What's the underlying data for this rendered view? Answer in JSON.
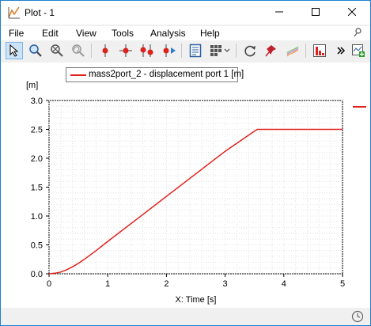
{
  "window": {
    "title": "Plot - 1",
    "controls": [
      "minimize",
      "maximize",
      "close"
    ]
  },
  "menu": {
    "items": [
      "File",
      "Edit",
      "View",
      "Tools",
      "Analysis",
      "Help"
    ],
    "pin_icon": "pin-icon"
  },
  "toolbar": {
    "icons": [
      "pointer-icon",
      "zoom-icon",
      "zoom-out-icon",
      "zoom-reset-icon",
      "marker-icon",
      "crosshair-marker-icon",
      "multi-marker-icon",
      "play-marker-icon",
      "export-icon",
      "grid-layout-icon",
      "refresh-icon",
      "pin-marker-icon",
      "waterfall-icon",
      "bar-chart-icon",
      "more-icon",
      "add-plot-icon"
    ],
    "active": "pointer-icon"
  },
  "plot": {
    "legend_label": "mass2port_2 - displacement port 1 [m]",
    "series_color": "#e0211c"
  },
  "chart_data": {
    "type": "line",
    "ylabel": "[m]",
    "xlabel": "X: Time [s]",
    "xlim": [
      0,
      5
    ],
    "ylim": [
      0,
      3
    ],
    "x_ticks": [
      "0",
      "1",
      "2",
      "3",
      "4",
      "5"
    ],
    "y_ticks": [
      "0.0",
      "0.5",
      "1.0",
      "1.5",
      "2.0",
      "2.5",
      "3.0"
    ],
    "grid": true,
    "legend_position": "top",
    "series": [
      {
        "name": "mass2port_2 - displacement port 1 [m]",
        "color": "#e0211c",
        "x": [
          0,
          0.1,
          0.2,
          0.3,
          0.4,
          0.5,
          0.6,
          0.8,
          1.0,
          1.5,
          2.0,
          2.5,
          3.0,
          3.5,
          3.55,
          4.0,
          4.5,
          5.0
        ],
        "y": [
          0,
          0.01,
          0.03,
          0.07,
          0.12,
          0.18,
          0.25,
          0.4,
          0.56,
          0.95,
          1.34,
          1.73,
          2.12,
          2.47,
          2.5,
          2.5,
          2.5,
          2.5
        ]
      }
    ]
  }
}
